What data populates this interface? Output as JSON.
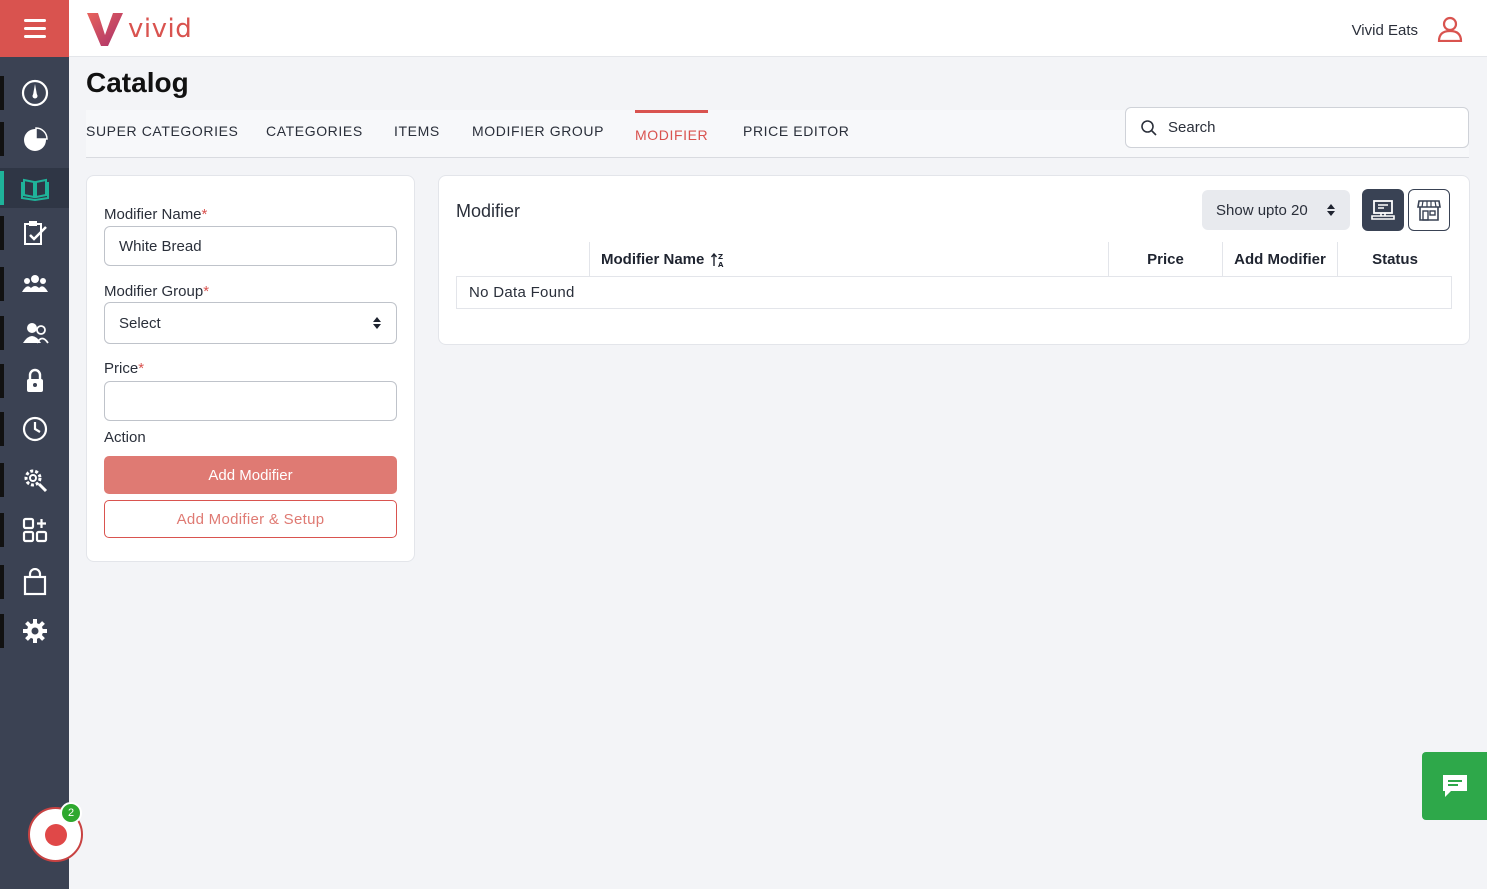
{
  "app": {
    "logo_text": "vivid",
    "account_name": "Vivid Eats",
    "brand_color": "#d9534f"
  },
  "rail": {
    "items": [
      {
        "icon": "dashboard-icon"
      },
      {
        "icon": "pie-chart-icon"
      },
      {
        "icon": "catalog-book-icon",
        "active": true
      },
      {
        "icon": "clipboard-check-icon"
      },
      {
        "icon": "users-group-icon"
      },
      {
        "icon": "staff-icon"
      },
      {
        "icon": "lock-icon"
      },
      {
        "icon": "clock-icon"
      },
      {
        "icon": "gear-search-icon"
      },
      {
        "icon": "apps-add-icon"
      },
      {
        "icon": "shopping-bag-icon"
      },
      {
        "icon": "settings-icon"
      }
    ],
    "record_badge": "2"
  },
  "page": {
    "title": "Catalog",
    "tabs": [
      {
        "label": "SUPER CATEGORIES"
      },
      {
        "label": "CATEGORIES"
      },
      {
        "label": "ITEMS"
      },
      {
        "label": "MODIFIER GROUP"
      },
      {
        "label": "MODIFIER",
        "active": true
      },
      {
        "label": "PRICE EDITOR"
      }
    ],
    "search_placeholder": "Search"
  },
  "form": {
    "name_label": "Modifier Name",
    "name_value": "White Bread",
    "group_label": "Modifier Group",
    "group_value": "Select",
    "price_label": "Price",
    "price_value": "",
    "action_label": "Action",
    "required_mark": "*",
    "add_button": "Add Modifier",
    "add_setup_button": "Add Modifier & Setup"
  },
  "list": {
    "title": "Modifier",
    "page_size": "Show upto 20",
    "columns": [
      "Modifier Name",
      "Price",
      "Add Modifier",
      "Status"
    ],
    "empty_text": "No Data Found"
  }
}
